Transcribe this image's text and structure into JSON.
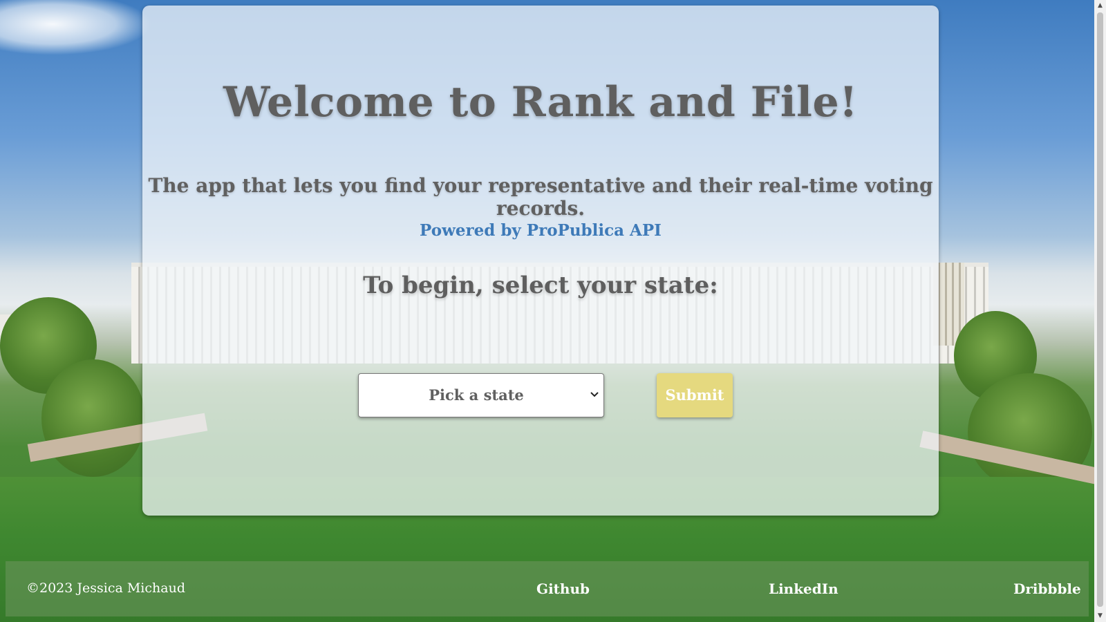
{
  "main": {
    "title": "Welcome to Rank and File!",
    "subtitle": "The app that lets you find your representative and their real-time voting records.",
    "powered_by": "Powered by ProPublica API",
    "prompt": "To begin, select your state:"
  },
  "form": {
    "state_select_value": "Pick a state",
    "submit_label": "Submit"
  },
  "footer": {
    "copyright": "©2023 Jessica Michaud",
    "links": [
      "Github",
      "LinkedIn",
      "Dribbble"
    ]
  },
  "colors": {
    "title_text": "#5f5f5f",
    "link_blue": "#3e7ab8",
    "submit_bg": "#e5d97f",
    "submit_text": "#ffffff",
    "footer_text": "#ffffff"
  },
  "icons": {
    "select_arrow": "chevron-down-icon",
    "scroll_up": "triangle-up-icon",
    "scroll_down": "triangle-down-icon"
  }
}
